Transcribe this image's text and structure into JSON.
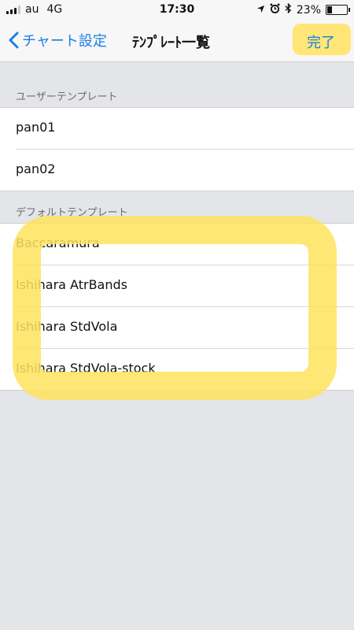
{
  "status_bar": {
    "carrier": "au",
    "network": "4G",
    "time": "17:30",
    "battery_percent": "23%",
    "battery_level": 0.23,
    "icons": [
      "signal-icon",
      "location-icon",
      "alarm-icon",
      "bluetooth-icon",
      "battery-icon"
    ]
  },
  "nav": {
    "back_label": "チャート設定",
    "title": "ﾃﾝﾌﾟﾚｰﾄ一覧",
    "done_label": "完了"
  },
  "sections": {
    "user": {
      "header": "ユーザーテンプレート",
      "items": [
        "pan01",
        "pan02"
      ]
    },
    "default": {
      "header": "デフォルトテンプレート",
      "items": [
        "Baccaramura",
        "Ishihara AtrBands",
        "Ishihara StdVola",
        "Ishihara StdVola-stock"
      ]
    }
  },
  "colors": {
    "accent": "#1a7fe5",
    "highlight": "#ffe35e",
    "background": "#e3e5e8"
  }
}
